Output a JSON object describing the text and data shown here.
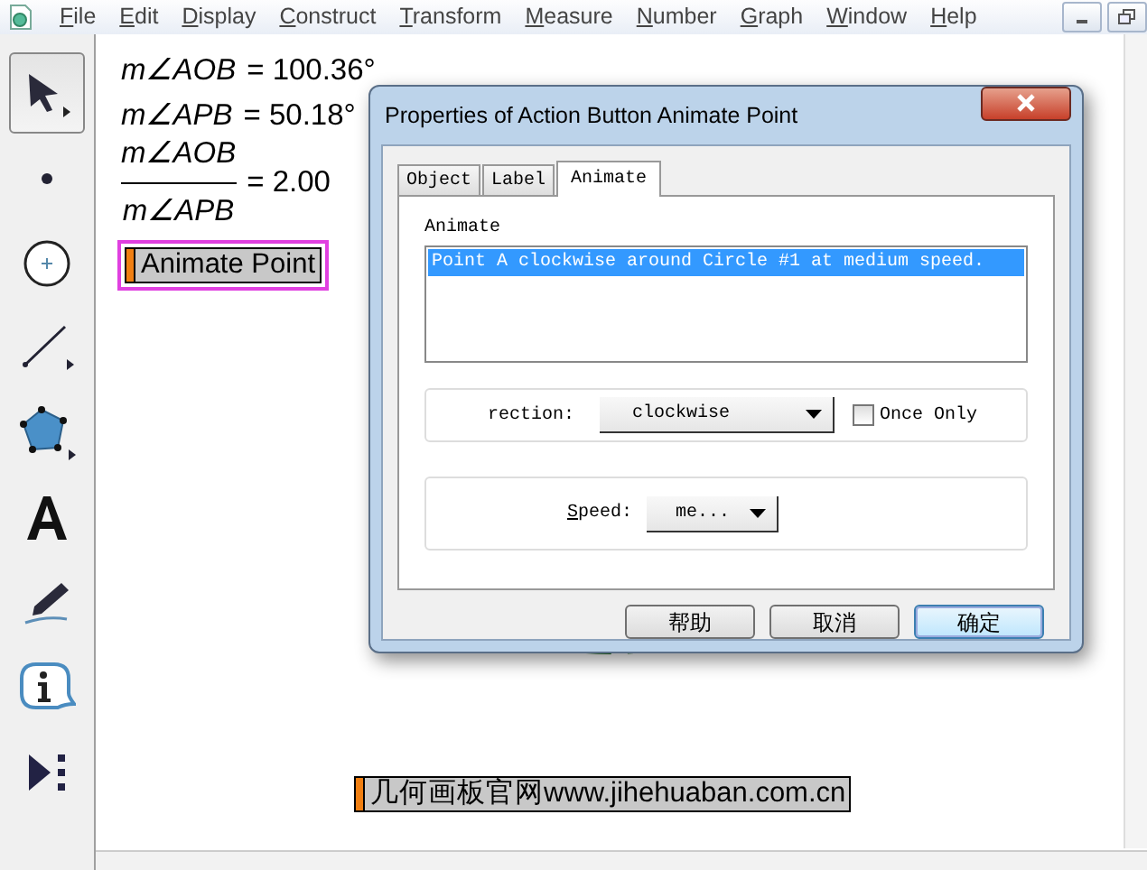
{
  "menu": [
    {
      "label": "File"
    },
    {
      "label": "Edit"
    },
    {
      "label": "Display"
    },
    {
      "label": "Construct"
    },
    {
      "label": "Transform"
    },
    {
      "label": "Measure"
    },
    {
      "label": "Number"
    },
    {
      "label": "Graph"
    },
    {
      "label": "Window"
    },
    {
      "label": "Help"
    }
  ],
  "tools": [
    {
      "kind": "select",
      "selected": true
    },
    {
      "kind": "point",
      "selected": false
    },
    {
      "kind": "compass",
      "selected": false
    },
    {
      "kind": "line",
      "selected": false
    },
    {
      "kind": "polygon",
      "selected": false
    },
    {
      "kind": "text",
      "selected": false
    },
    {
      "kind": "marker",
      "selected": false
    },
    {
      "kind": "info",
      "selected": false
    },
    {
      "kind": "custom",
      "selected": false
    }
  ],
  "measurements": [
    {
      "kind": "equation",
      "term": "m∠AOB",
      "value": "= 100.36°"
    },
    {
      "kind": "equation",
      "term": "m∠APB",
      "value": "= 50.18°"
    },
    {
      "kind": "fraction",
      "numerator": "m∠AOB",
      "denominator": "m∠APB",
      "value": "= 2.00"
    }
  ],
  "action_buttons": [
    {
      "label": "Animate Point",
      "selected": true
    },
    {
      "label": "几何画板官网www.jihehuaban.com.cn",
      "selected": false
    }
  ],
  "dialog": {
    "title": "Properties of Action Button Animate Point",
    "tabs": [
      {
        "label": "Object",
        "selected": false
      },
      {
        "label": "Label",
        "selected": false
      },
      {
        "label": "Animate",
        "selected": true
      }
    ],
    "animate_label": "Animate",
    "animate_items": [
      {
        "text": "Point A clockwise around Circle #1 at medium speed.",
        "selected": true
      }
    ],
    "direction_label": "rection:",
    "direction_value": "clockwise",
    "once_only": {
      "label": "Once Only",
      "checked": false
    },
    "speed_label": "Speed:",
    "speed_value": "me...",
    "buttons": [
      {
        "label": "帮助",
        "default": false
      },
      {
        "label": "取消",
        "default": false
      },
      {
        "label": "确定",
        "default": true
      }
    ]
  }
}
